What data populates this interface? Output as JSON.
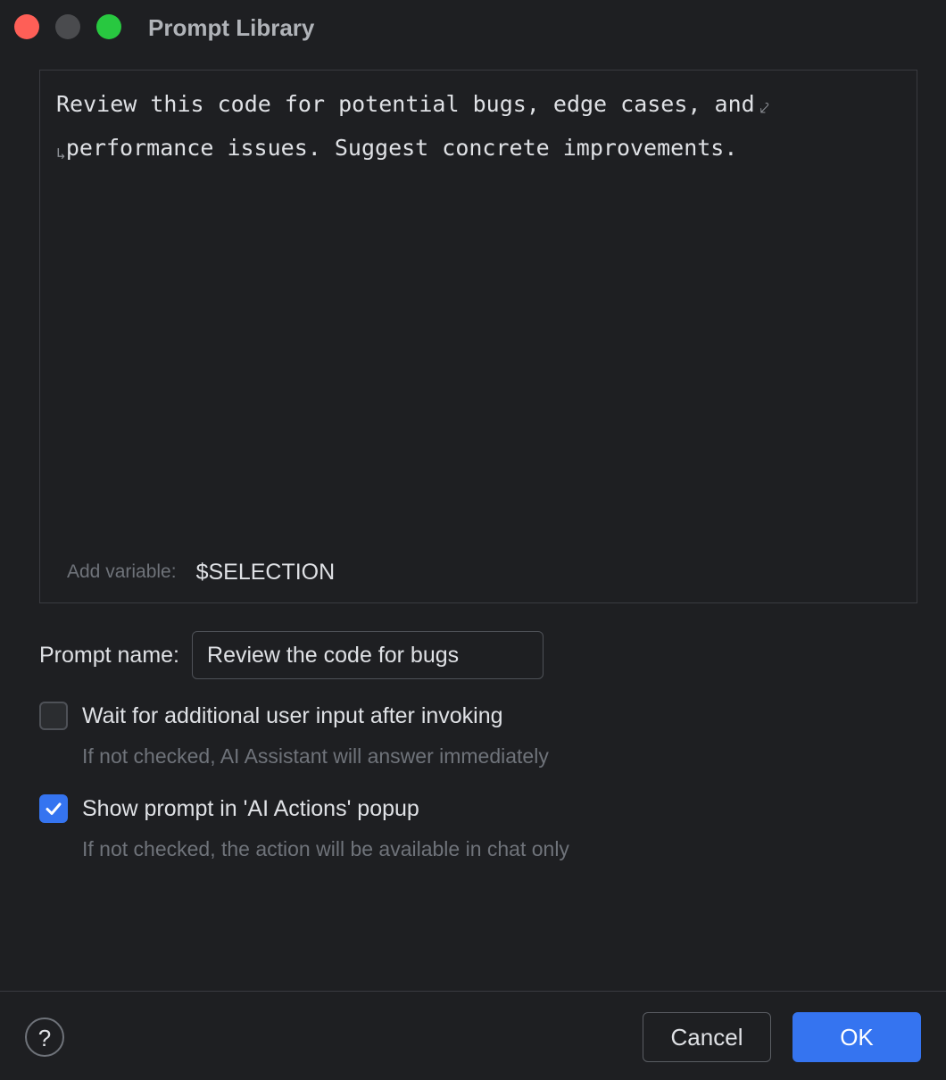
{
  "window": {
    "title": "Prompt Library"
  },
  "editor": {
    "line1": "Review this code for potential bugs, edge cases, and",
    "line2": "performance issues. Suggest concrete improvements.",
    "wrap_icon_end": "⤦",
    "wrap_icon_start": "↳",
    "add_variable_label": "Add variable:",
    "variables": [
      "$SELECTION"
    ]
  },
  "prompt_name": {
    "label": "Prompt name:",
    "value": "Review the code for bugs"
  },
  "options": [
    {
      "label": "Wait for additional user input after invoking",
      "hint": "If not checked, AI Assistant will answer immediately",
      "checked": false
    },
    {
      "label": "Show prompt in 'AI Actions' popup",
      "hint": "If not checked, the action will be available in chat only",
      "checked": true
    }
  ],
  "footer": {
    "help_label": "?",
    "cancel_label": "Cancel",
    "ok_label": "OK"
  },
  "colors": {
    "background": "#1e1f22",
    "accent": "#3574f0",
    "close": "#fe5f57",
    "minimize": "#4a4b4e",
    "maximize": "#28c840"
  }
}
